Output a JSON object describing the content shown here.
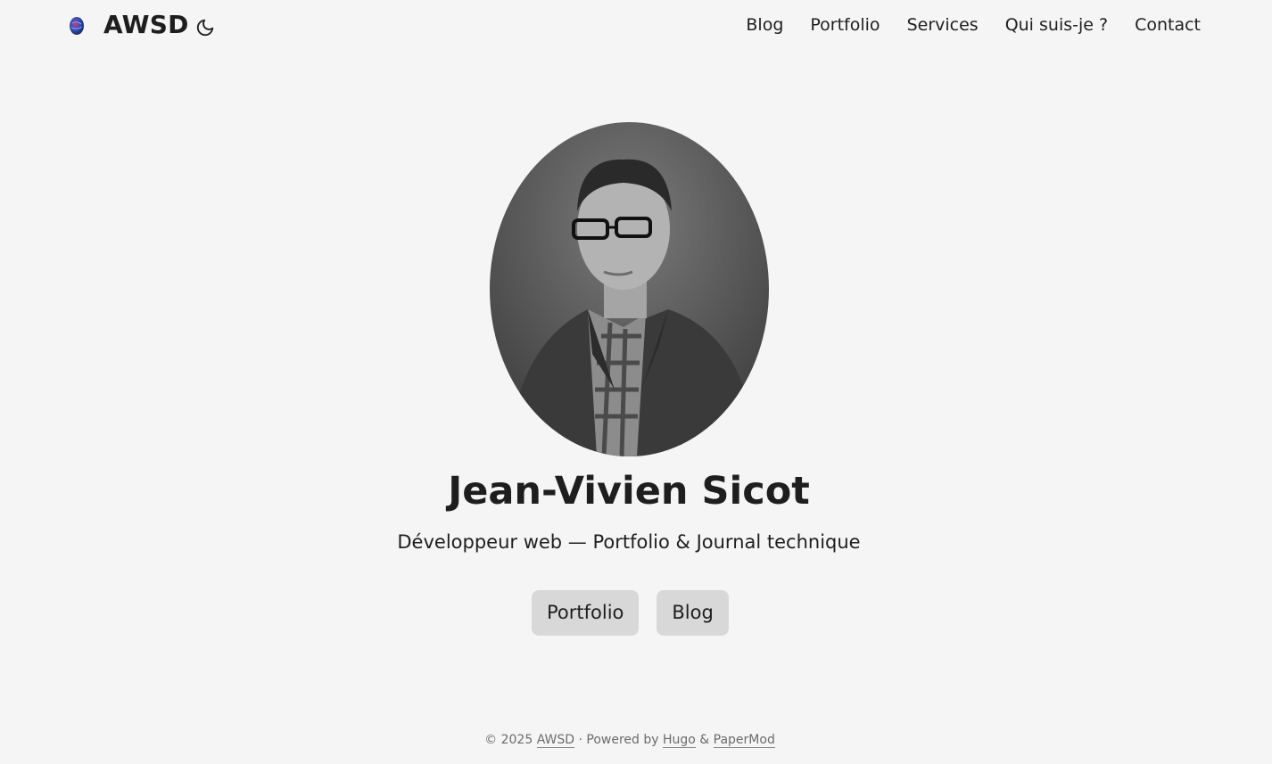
{
  "header": {
    "logo_icon": "planet-logo-icon",
    "title": "AWSD",
    "theme_toggle_icon": "moon-icon"
  },
  "nav": {
    "items": [
      {
        "label": "Blog"
      },
      {
        "label": "Portfolio"
      },
      {
        "label": "Services"
      },
      {
        "label": "Qui suis-je ?"
      },
      {
        "label": "Contact"
      }
    ]
  },
  "profile": {
    "avatar_alt": "portrait",
    "name": "Jean-Vivien Sicot",
    "subtitle": "Développeur web — Portfolio & Journal technique",
    "buttons": [
      {
        "label": "Portfolio"
      },
      {
        "label": "Blog"
      }
    ]
  },
  "footer": {
    "copyright": "© 2025",
    "site_link": "AWSD",
    "powered_by": "· Powered by",
    "hugo_link": "Hugo",
    "amp": "&",
    "papermod_link": "PaperMod"
  },
  "colors": {
    "background": "#f5f5f5",
    "text": "#1e1e1e",
    "button_bg": "#d8d8d8",
    "footer_text": "#6b6b6b"
  }
}
